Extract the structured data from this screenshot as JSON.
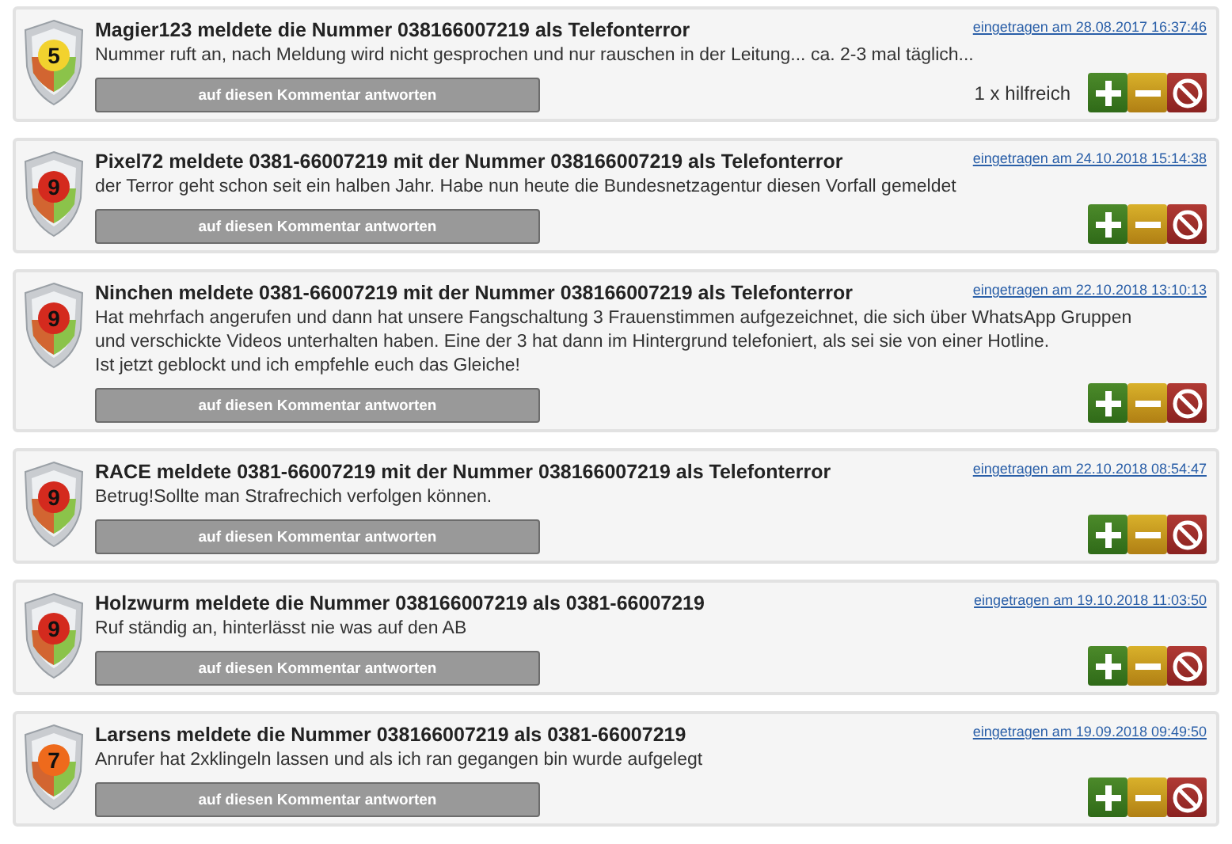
{
  "comments": [
    {
      "score": "5",
      "color": "#f2d22e",
      "title": "Magier123 meldete die Nummer 038166007219 als Telefonterror",
      "date": "eingetragen am 28.08.2017 16:37:46",
      "body": [
        "Nummer ruft an, nach Meldung wird nicht gesprochen und nur rauschen in der Leitung... ca. 2-3 mal täglich..."
      ],
      "reply": "auf diesen Kommentar antworten",
      "helpful": "1 x hilfreich"
    },
    {
      "score": "9",
      "color": "#d42a1e",
      "title": "Pixel72 meldete 0381-66007219 mit der Nummer 038166007219 als Telefonterror",
      "date": "eingetragen am 24.10.2018 15:14:38",
      "body": [
        "der Terror geht schon seit ein halben Jahr. Habe nun heute die Bundesnetzagentur diesen Vorfall gemeldet"
      ],
      "reply": "auf diesen Kommentar antworten"
    },
    {
      "score": "9",
      "color": "#d42a1e",
      "title": "Ninchen meldete 0381-66007219 mit der Nummer 038166007219 als Telefonterror",
      "date": "eingetragen am 22.10.2018 13:10:13",
      "body": [
        "Hat mehrfach angerufen und dann hat unsere Fangschaltung 3 Frauenstimmen aufgezeichnet, die sich über WhatsApp Gruppen und verschickte Videos unterhalten haben. Eine der 3 hat dann im Hintergrund telefoniert, als sei sie von einer Hotline.",
        "Ist jetzt geblockt und ich empfehle euch das Gleiche!"
      ],
      "reply": "auf diesen Kommentar antworten"
    },
    {
      "score": "9",
      "color": "#d42a1e",
      "title": "RACE meldete 0381-66007219 mit der Nummer 038166007219 als Telefonterror",
      "date": "eingetragen am 22.10.2018 08:54:47",
      "body": [
        "Betrug!Sollte man Strafrechich verfolgen können."
      ],
      "reply": "auf diesen Kommentar antworten"
    },
    {
      "score": "9",
      "color": "#d42a1e",
      "title": "Holzwurm meldete die Nummer 038166007219 als 0381-66007219",
      "date": "eingetragen am 19.10.2018 11:03:50",
      "body": [
        "Ruf ständig an, hinterlässt nie was auf den AB"
      ],
      "reply": "auf diesen Kommentar antworten"
    },
    {
      "score": "7",
      "color": "#ee6a1c",
      "title": "Larsens meldete die Nummer 038166007219 als 0381-66007219",
      "date": "eingetragen am 19.09.2018 09:49:50",
      "body": [
        "Anrufer hat 2xklingeln lassen und als ich ran gegangen bin wurde aufgelegt"
      ],
      "reply": "auf diesen Kommentar antworten"
    }
  ]
}
